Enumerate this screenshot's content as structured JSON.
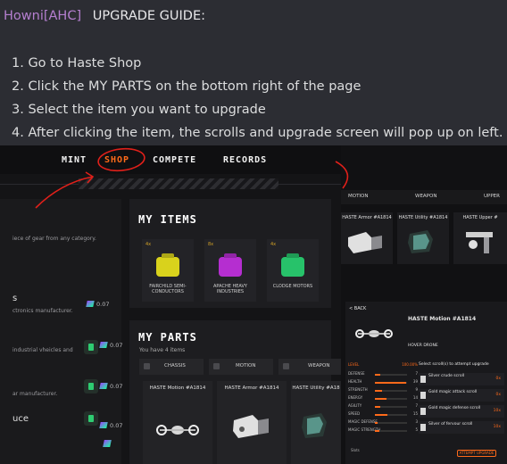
{
  "message": {
    "author": "Howni[AHC]",
    "title": "UPGRADE GUIDE:",
    "steps": [
      "1. Go to Haste Shop",
      "2. Click the MY PARTS on the bottom right of the page",
      "3. Select the item you want to upgrade",
      "4. After clicking the item, the scrolls and upgrade screen will pop up on left."
    ]
  },
  "game_left": {
    "nav": [
      "MINT",
      "SHOP",
      "COMPETE",
      "RECORDS"
    ],
    "active_nav": "SHOP",
    "left_column": {
      "intro": "iece of gear from any category.",
      "rows": [
        {
          "title": "s",
          "desc": "ctronics manufacturer.",
          "price": "0.07"
        },
        {
          "title": "",
          "desc": "industrial vheicles and",
          "price": "0.07"
        },
        {
          "title": "",
          "desc": "ar manufacturer.",
          "price": "0.07"
        },
        {
          "title": "uce",
          "desc": "",
          "price": "0.07"
        }
      ]
    },
    "my_items": {
      "title": "MY ITEMS",
      "cards": [
        {
          "level": "4x",
          "name": "FAIRCHILD SEMI-CONDUCTORS",
          "color": "#d9d21c"
        },
        {
          "level": "8x",
          "name": "APACHE HEAVY INDUSTRIES",
          "color": "#b52ed0"
        },
        {
          "level": "4x",
          "name": "CLODGE MOTORS",
          "color": "#27c26a"
        }
      ]
    },
    "my_parts": {
      "title": "MY PARTS",
      "count": "You have 4 items",
      "tabs": [
        "CHASSIS",
        "MOTION",
        "WEAPON"
      ],
      "cards": [
        "HASTE Motion #A1814",
        "HASTE Armor #A1814",
        "HASTE Utility #A18"
      ]
    }
  },
  "game_right": {
    "tabs": [
      "MOTION",
      "WEAPON",
      "UPPER"
    ],
    "cards": [
      "HASTE Armor #A1814",
      "HASTE Utility #A1814",
      "HASTE Upper #"
    ],
    "detail": {
      "back": "< BACK",
      "title": "HASTE Motion #A1814",
      "subtitle": "HOVER DRONE",
      "stats_header": "LEVEL",
      "stats_value": "100.00%",
      "stats": [
        {
          "name": "DEFENSE",
          "value": "7"
        },
        {
          "name": "HEALTH",
          "value": "39"
        },
        {
          "name": "STRENGTH",
          "value": "9"
        },
        {
          "name": "ENERGY",
          "value": "14"
        },
        {
          "name": "AGILITY",
          "value": "7"
        },
        {
          "name": "SPEED",
          "value": "15"
        },
        {
          "name": "MAGIC DEFENSE",
          "value": "3"
        },
        {
          "name": "MAGIC STRENGTH",
          "value": "5"
        }
      ],
      "scroll_header": "Select scroll(s) to attempt upgrade",
      "scrolls": [
        {
          "name": "Silver crude scroll",
          "cost": "0x"
        },
        {
          "name": "Gold magic attack scroll",
          "cost": "0x"
        },
        {
          "name": "Gold magic defense scroll",
          "cost": "10x"
        },
        {
          "name": "Silver of fervour scroll",
          "cost": "10x"
        }
      ],
      "slots_label": "Slots",
      "upgrade_button": "ATTEMPT UPGRADE"
    }
  }
}
